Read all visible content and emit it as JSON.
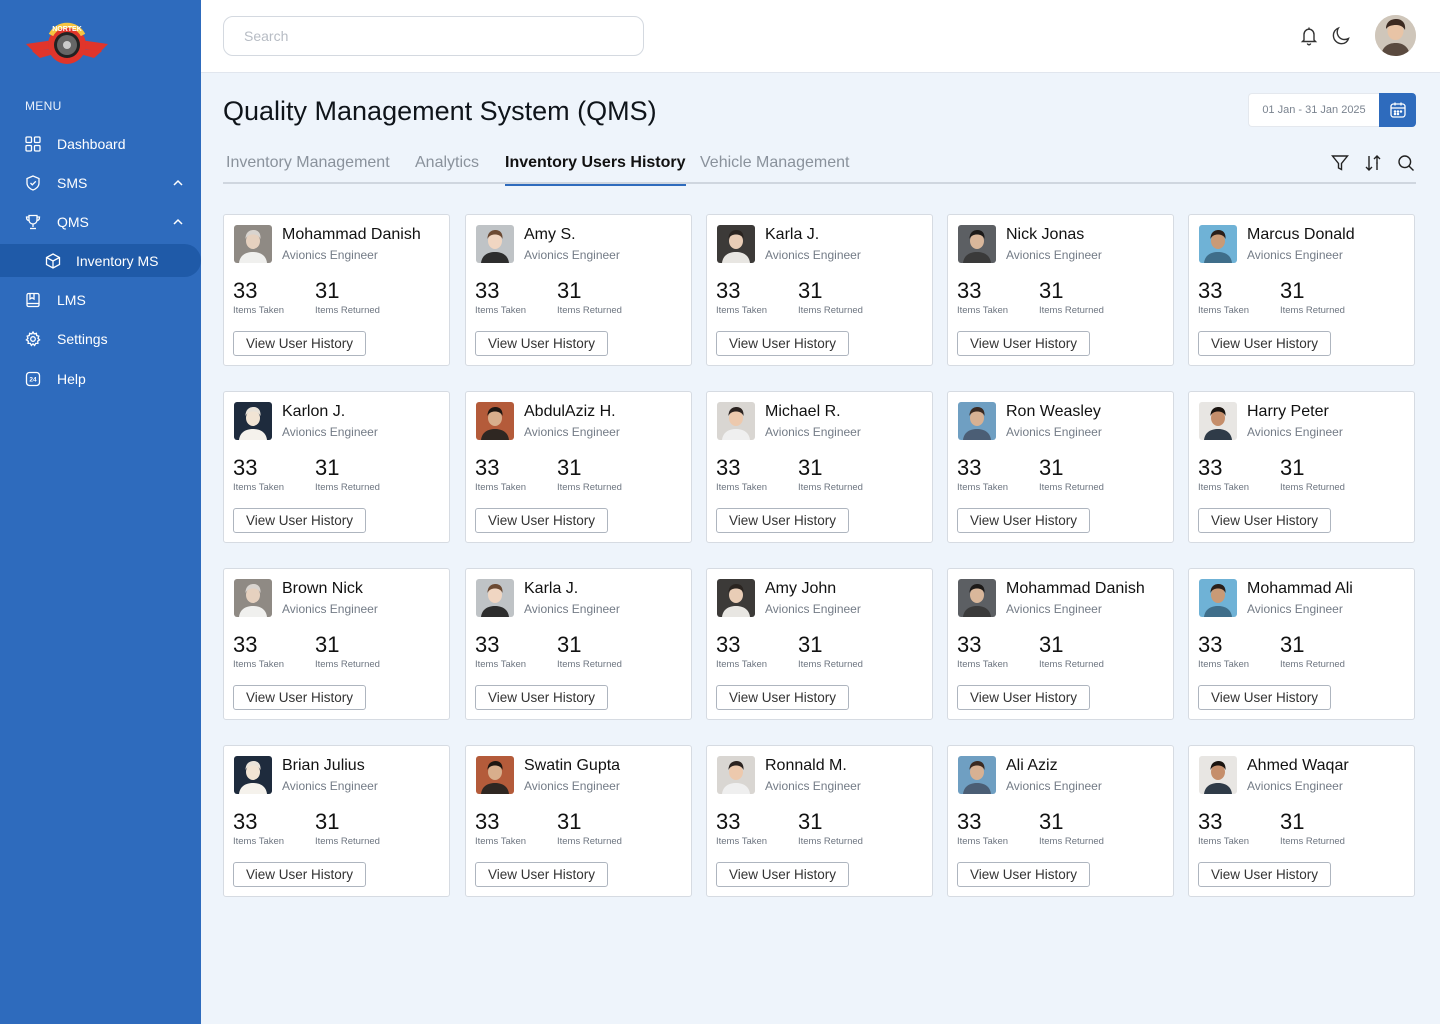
{
  "brand": {
    "logo_text": "NORTEK",
    "accent": "#2e6bbd",
    "logo_red": "#e0352b"
  },
  "sidebar": {
    "menu_title": "MENU",
    "items": [
      {
        "label": "Dashboard",
        "icon": "grid-icon"
      },
      {
        "label": "SMS",
        "icon": "shield-icon",
        "expandable": true
      },
      {
        "label": "QMS",
        "icon": "trophy-icon",
        "expandable": true
      },
      {
        "label": "Inventory MS",
        "icon": "box-icon",
        "sub": true,
        "active": true
      },
      {
        "label": "LMS",
        "icon": "book-icon"
      },
      {
        "label": "Settings",
        "icon": "gear-icon"
      },
      {
        "label": "Help",
        "icon": "help-24-icon"
      }
    ]
  },
  "header": {
    "search_placeholder": "Search"
  },
  "page": {
    "title": "Quality Management System (QMS)",
    "date_range": "01 Jan - 31 Jan 2025"
  },
  "tabs": [
    {
      "label": "Inventory Management",
      "active": false
    },
    {
      "label": "Analytics",
      "active": false
    },
    {
      "label": "Inventory Users History",
      "active": true
    },
    {
      "label": "Vehicle Management",
      "active": false
    }
  ],
  "card_labels": {
    "taken": "Items Taken",
    "returned": "Items Returned",
    "button": "View User History"
  },
  "users": [
    {
      "name": "Mohammad Danish",
      "role": "Avionics Engineer",
      "taken": "33",
      "returned": "31"
    },
    {
      "name": "Amy S.",
      "role": "Avionics Engineer",
      "taken": "33",
      "returned": "31"
    },
    {
      "name": "Karla J.",
      "role": "Avionics Engineer",
      "taken": "33",
      "returned": "31"
    },
    {
      "name": "Nick Jonas",
      "role": "Avionics Engineer",
      "taken": "33",
      "returned": "31"
    },
    {
      "name": "Marcus Donald",
      "role": "Avionics Engineer",
      "taken": "33",
      "returned": "31"
    },
    {
      "name": "Karlon J.",
      "role": "Avionics Engineer",
      "taken": "33",
      "returned": "31"
    },
    {
      "name": "AbdulAziz H.",
      "role": "Avionics Engineer",
      "taken": "33",
      "returned": "31"
    },
    {
      "name": "Michael R.",
      "role": "Avionics Engineer",
      "taken": "33",
      "returned": "31"
    },
    {
      "name": "Ron Weasley",
      "role": "Avionics Engineer",
      "taken": "33",
      "returned": "31"
    },
    {
      "name": "Harry Peter",
      "role": "Avionics Engineer",
      "taken": "33",
      "returned": "31"
    },
    {
      "name": "Brown Nick",
      "role": "Avionics Engineer",
      "taken": "33",
      "returned": "31"
    },
    {
      "name": "Karla J.",
      "role": "Avionics Engineer",
      "taken": "33",
      "returned": "31"
    },
    {
      "name": "Amy John",
      "role": "Avionics Engineer",
      "taken": "33",
      "returned": "31"
    },
    {
      "name": "Mohammad Danish",
      "role": "Avionics Engineer",
      "taken": "33",
      "returned": "31"
    },
    {
      "name": "Mohammad Ali",
      "role": "Avionics Engineer",
      "taken": "33",
      "returned": "31"
    },
    {
      "name": "Brian Julius",
      "role": "Avionics Engineer",
      "taken": "33",
      "returned": "31"
    },
    {
      "name": "Swatin Gupta",
      "role": "Avionics Engineer",
      "taken": "33",
      "returned": "31"
    },
    {
      "name": "Ronnald M.",
      "role": "Avionics Engineer",
      "taken": "33",
      "returned": "31"
    },
    {
      "name": "Ali Aziz",
      "role": "Avionics Engineer",
      "taken": "33",
      "returned": "31"
    },
    {
      "name": "Ahmed Waqar",
      "role": "Avionics Engineer",
      "taken": "33",
      "returned": "31"
    }
  ]
}
